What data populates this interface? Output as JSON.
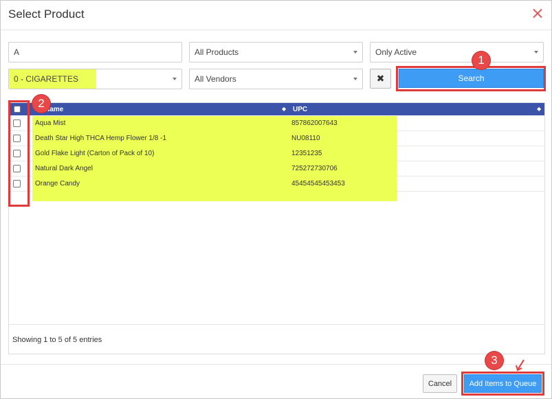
{
  "dialog": {
    "title": "Select Product"
  },
  "filters": {
    "search_value": "A",
    "product_type": "All Products",
    "status": "Only Active",
    "category": "0 - CIGARETTES",
    "vendor": "All Vendors",
    "clear_icon": "x-icon",
    "search_label": "Search"
  },
  "table": {
    "columns": [
      "Name",
      "UPC"
    ],
    "rows": [
      {
        "name": "Aqua Mist",
        "upc": "857862007643"
      },
      {
        "name": "Death Star High THCA Hemp Flower 1/8 -1",
        "upc": "NU08110"
      },
      {
        "name": "Gold Flake Light (Carton of Pack of 10)",
        "upc": "12351235"
      },
      {
        "name": "Natural Dark Angel",
        "upc": "725272730706"
      },
      {
        "name": "Orange Candy",
        "upc": "45454545453453"
      }
    ],
    "info": "Showing 1 to 5 of 5 entries"
  },
  "footer": {
    "cancel_label": "Cancel",
    "add_label": "Add Items to Queue"
  },
  "annotations": {
    "badges": [
      "1",
      "2",
      "3"
    ],
    "badge_color": "#e84848",
    "highlight_color": "#ebff55",
    "accent_color": "#3f9cf5"
  }
}
